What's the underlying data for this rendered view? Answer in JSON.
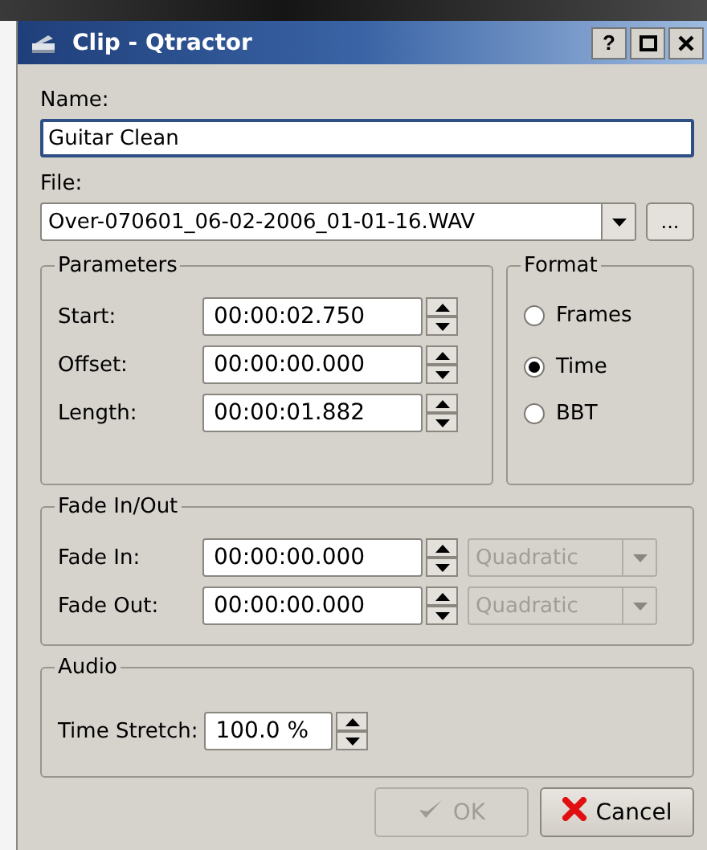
{
  "window": {
    "title": "Clip - Qtractor",
    "help": "?"
  },
  "name": {
    "label": "Name:",
    "value": "Guitar Clean",
    "focused": true
  },
  "file": {
    "label": "File:",
    "value": "Over-070601_06-02-2006_01-01-16.WAV",
    "browse": "..."
  },
  "parameters": {
    "title": "Parameters",
    "rows": [
      {
        "label": "Start:",
        "value": "00:00:02.750"
      },
      {
        "label": "Offset:",
        "value": "00:00:00.000"
      },
      {
        "label": "Length:",
        "value": "00:00:01.882"
      }
    ]
  },
  "format": {
    "title": "Format",
    "options": [
      {
        "label": "Frames",
        "selected": false
      },
      {
        "label": "Time",
        "selected": true
      },
      {
        "label": "BBT",
        "selected": false
      }
    ]
  },
  "fade": {
    "title": "Fade In/Out",
    "rows": [
      {
        "label": "Fade In:",
        "value": "00:00:00.000",
        "curve": "Quadratic",
        "curve_disabled": true
      },
      {
        "label": "Fade Out:",
        "value": "00:00:00.000",
        "curve": "Quadratic",
        "curve_disabled": true
      }
    ]
  },
  "audio": {
    "title": "Audio",
    "rows": [
      {
        "label": "Time Stretch:",
        "value": "100.0 %"
      }
    ]
  },
  "buttons": [
    {
      "label": "OK",
      "kind": "ok",
      "disabled": true
    },
    {
      "label": "Cancel",
      "kind": "cancel",
      "disabled": false
    }
  ]
}
